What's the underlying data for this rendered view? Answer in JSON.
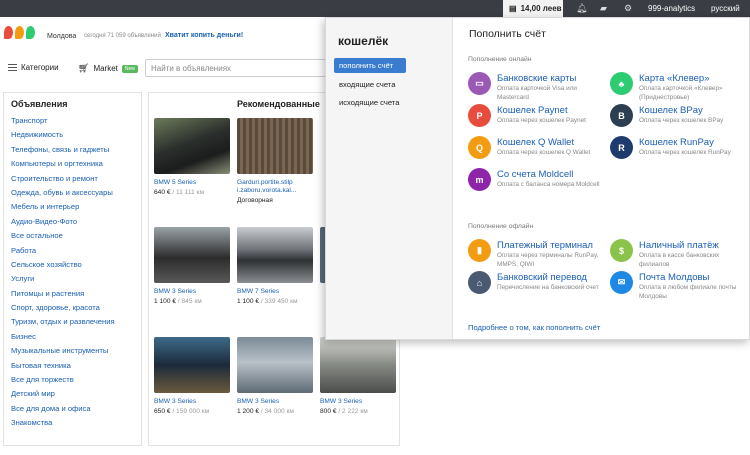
{
  "topbar": {
    "balance": "14,00 леев",
    "user": "999-analytics",
    "lang": "русский",
    "icons": [
      "bell-icon",
      "messages-icon",
      "gear-icon"
    ]
  },
  "header": {
    "region": "Молдова",
    "today": "сегодня 71 059 объявлений",
    "promo": "Хватит копить деньги!",
    "categories_label": "Категории",
    "market_label": "Market",
    "market_badge": "New",
    "search_placeholder": "Найти в объявлениях"
  },
  "categories": {
    "title": "Объявления",
    "items": [
      "Транспорт",
      "Недвижимость",
      "Телефоны, связь и гаджеты",
      "Компьютеры и оргтехника",
      "Строительство и ремонт",
      "Одежда, обувь и аксессуары",
      "Мебель и интерьер",
      "Аудио-Видео-Фото",
      "Все остальное",
      "Работа",
      "Сельское хозяйство",
      "Услуги",
      "Питомцы и растения",
      "Спорт, здоровье, красота",
      "Туризм, отдых и развлечения",
      "Бизнес",
      "Музыкальные инструменты",
      "Бытовая техника",
      "Все для торжеств",
      "Детский мир",
      "Все для дома и офиса",
      "Знакомства"
    ]
  },
  "recommended": {
    "title": "Рекомендованные",
    "cards": [
      {
        "title": "BMW 5 Series",
        "price": "640 €",
        "km": "/ 11 111 км"
      },
      {
        "title": "Garduri.portite.stilp i.zaboru.vorota.kal...",
        "price": "Договорная",
        "km": ""
      },
      {
        "title": "BMW 3 Series",
        "price": "1 100 €",
        "km": "/ 845 км"
      },
      {
        "title": "BMW 7 Series",
        "price": "1 100 €",
        "km": "/ 339 450 км"
      },
      {
        "title": "BMW 3 Series",
        "price": "650 €",
        "km": "/ 159 000 км"
      },
      {
        "title": "BMW 3 Series",
        "price": "1 200 €",
        "km": "/ 34 000 км"
      },
      {
        "title": "BMW 3 Series",
        "price": "800 €",
        "km": "/ 2 222 км"
      }
    ]
  },
  "wallet": {
    "title": "кошелёк",
    "menu": [
      "пополнить счёт",
      "входящие счета",
      "исходящие счета"
    ],
    "heading": "Пополнить счёт",
    "online_label": "Пополнение онлайн",
    "offline_label": "Пополнение офлайн",
    "more_link": "Подробнее о том, как пополнить счёт",
    "online": [
      {
        "name": "Банковские карты",
        "desc": "Оплата карточкой Visa или Mastercard",
        "color": "#9b59b6",
        "icon": "credit-card-icon"
      },
      {
        "name": "Карта «Клевер»",
        "desc": "Оплата карточкой «Клевер» (Приднестровье)",
        "color": "#2ecc71",
        "icon": "klever-logo-icon"
      },
      {
        "name": "Кошелек Paynet",
        "desc": "Оплата через кошелек Paynet",
        "color": "#e74c3c",
        "icon": "paynet-logo-icon"
      },
      {
        "name": "Кошелек BPay",
        "desc": "Оплата через кошелек BPay",
        "color": "#2c3e50",
        "icon": "bpay-logo-icon"
      },
      {
        "name": "Кошелек Q Wallet",
        "desc": "Оплата через кошелек Q Wallet",
        "color": "#f39c12",
        "icon": "qwallet-logo-icon"
      },
      {
        "name": "Кошелек RunPay",
        "desc": "Оплата через кошелек RunPay",
        "color": "#1f3a6d",
        "icon": "runpay-logo-icon"
      },
      {
        "name": "Со счета Moldcell",
        "desc": "Оплата с баланса номера Moldcell",
        "color": "#8e24aa",
        "icon": "moldcell-logo-icon"
      }
    ],
    "offline": [
      {
        "name": "Платежный терминал",
        "desc": "Оплата через терминалы RunPay, MMPS, QIWI",
        "color": "#f39c12",
        "icon": "terminal-icon"
      },
      {
        "name": "Наличный платёж",
        "desc": "Оплата в кассе банковских филиалов",
        "color": "#8bc34a",
        "icon": "cash-icon"
      },
      {
        "name": "Банковский перевод",
        "desc": "Перечисление на банковский счет",
        "color": "#4a5a73",
        "icon": "bank-icon"
      },
      {
        "name": "Почта Молдовы",
        "desc": "Оплата в любом филиале почты Молдовы",
        "color": "#1e88e5",
        "icon": "post-icon"
      }
    ]
  }
}
